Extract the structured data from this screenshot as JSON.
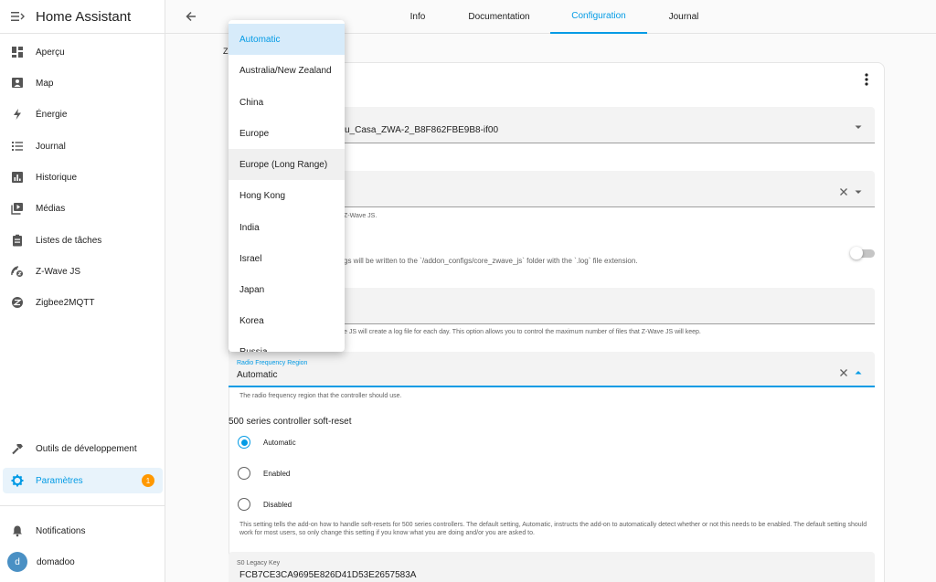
{
  "app": {
    "title": "Home Assistant"
  },
  "sidebar": {
    "items": [
      {
        "label": "Aperçu",
        "icon": "dashboard-icon"
      },
      {
        "label": "Map",
        "icon": "map-icon"
      },
      {
        "label": "Énergie",
        "icon": "lightning-icon"
      },
      {
        "label": "Journal",
        "icon": "list-icon"
      },
      {
        "label": "Historique",
        "icon": "chart-icon"
      },
      {
        "label": "Médias",
        "icon": "media-icon"
      },
      {
        "label": "Listes de tâches",
        "icon": "clipboard-icon"
      },
      {
        "label": "Z-Wave JS",
        "icon": "zwave-icon"
      },
      {
        "label": "Zigbee2MQTT",
        "icon": "zigbee-icon"
      }
    ],
    "dev_tools": "Outils de développement",
    "settings": "Paramètres",
    "settings_badge": "1",
    "notifications": "Notifications",
    "user": {
      "initial": "d",
      "name": "domadoo"
    }
  },
  "tabs": [
    "Info",
    "Documentation",
    "Configuration",
    "Journal"
  ],
  "active_tab": "Configuration",
  "config": {
    "partial_heading": "Z",
    "device_value": "u_Casa_ZWA-2_B8F862FBE9B8-if00",
    "helper_zwave": "Z-Wave JS.",
    "helper_logs": "gs will be written to the `/addon_configs/core_zwave_js` folder with the `.log` file extension.",
    "helper_logfiles": "e JS will create a log file for each day. This option allows you to control the maximum number of files that Z-Wave JS will keep.",
    "region": {
      "label": "Radio Frequency Region",
      "value": "Automatic",
      "helper": "The radio frequency region that the controller should use."
    },
    "soft_reset": {
      "title": "500 series controller soft-reset",
      "options": [
        "Automatic",
        "Enabled",
        "Disabled"
      ],
      "selected": "Automatic",
      "helper": "This setting tells the add-on how to handle soft-resets for 500 series controllers. The default setting, Automatic, instructs the add-on to automatically detect whether or not this needs to be enabled. The default setting should work for most users, so only change this setting if you know what you are doing and/or you are asked to."
    },
    "s0_key": {
      "label": "S0 Legacy Key",
      "value": "FCB7CE3CA9695E826D41D53E2657583A"
    }
  },
  "dropdown": {
    "options": [
      "Automatic",
      "Australia/New Zealand",
      "China",
      "Europe",
      "Europe (Long Range)",
      "Hong Kong",
      "India",
      "Israel",
      "Japan",
      "Korea",
      "Russia"
    ],
    "selected": "Automatic",
    "hovered": "Europe (Long Range)"
  },
  "colors": {
    "accent": "#039be5",
    "badge": "#ff9800"
  }
}
